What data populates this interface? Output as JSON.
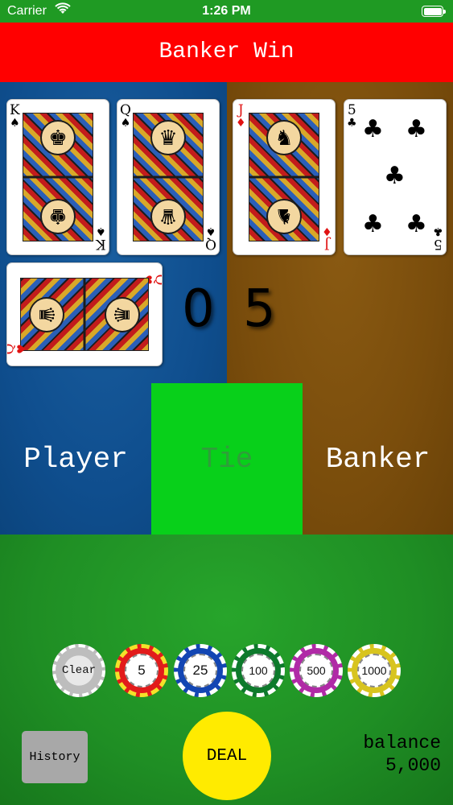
{
  "status_bar": {
    "carrier": "Carrier",
    "time": "1:26 PM"
  },
  "result_banner": "Banker Win",
  "player_hand": {
    "cards": [
      {
        "rank": "K",
        "suit": "♠",
        "color": "black",
        "figure": "♚"
      },
      {
        "rank": "Q",
        "suit": "♠",
        "color": "black",
        "figure": "♛"
      },
      {
        "rank": "Q",
        "suit": "♥",
        "color": "red",
        "figure": "♛"
      }
    ],
    "score": "0"
  },
  "banker_hand": {
    "cards": [
      {
        "rank": "J",
        "suit": "♦",
        "color": "red",
        "figure": "♞"
      },
      {
        "rank": "5",
        "suit": "♣",
        "color": "black"
      }
    ],
    "score": "5"
  },
  "bet_zones": {
    "player": "Player",
    "tie": "Tie",
    "banker": "Banker"
  },
  "chips": {
    "clear": "Clear",
    "c5": "5",
    "c25": "25",
    "c100": "100",
    "c500": "500",
    "c1000": "1000"
  },
  "history_label": "History",
  "deal_label": "DEAL",
  "balance": {
    "label": "balance",
    "value": "5,000"
  },
  "colors": {
    "banner": "#ff0000",
    "player_area": "#0f4e8e",
    "banker_area": "#7a4d0c",
    "tie_zone": "#08d01a",
    "felt": "#1f8e24",
    "deal_button": "#ffeb00"
  }
}
